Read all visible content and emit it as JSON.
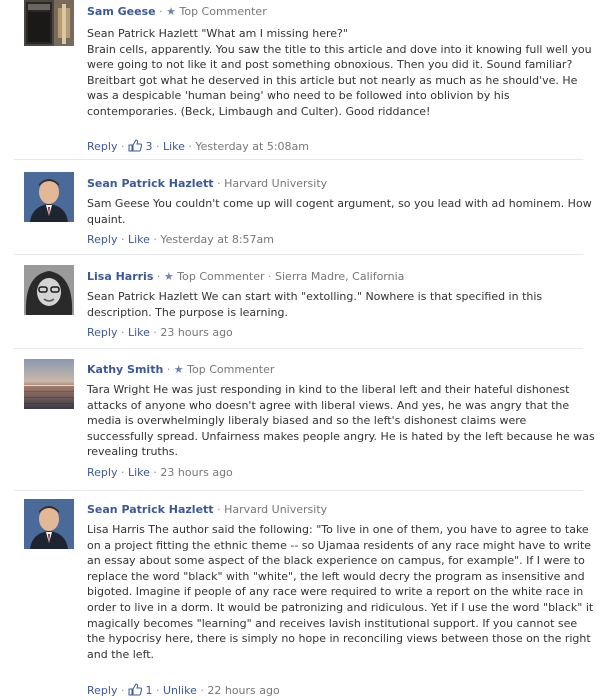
{
  "labels": {
    "reply": "Reply",
    "like": "Like",
    "unlike": "Unlike",
    "dot": "·"
  },
  "comments": [
    {
      "author": "Sam Geese",
      "meta": "Top Commenter",
      "body": [
        "Sean Patrick Hazlett \"What am I missing here?\"",
        "Brain cells, apparently. You saw the title to this article and dove into it knowing full well you were going to not like it and post something obnoxious. Then you did it. Sound familiar?",
        "Breitbart got what he deserved in this article but not nearly as much as he should've. He was a despicable 'human being' who need to be followed into oblivion by his contemporaries. (Beck, Limbaugh and Culter). Good riddance!"
      ],
      "like_count": "3",
      "time": "Yesterday at 5:08am"
    },
    {
      "author": "Sean Patrick Hazlett",
      "meta": "Harvard University",
      "body": [
        "Sam Geese You couldn't come up will cogent argument, so you lead with ad hominem. How quaint."
      ],
      "time": "Yesterday at 8:57am"
    },
    {
      "author": "Lisa Harris",
      "meta": "Top Commenter",
      "location": "Sierra Madre, California",
      "body": [
        "Sean Patrick Hazlett We can start with \"extolling.\" Nowhere is that specified in this description. The purpose is learning."
      ],
      "time": "23 hours ago"
    },
    {
      "author": "Kathy Smith",
      "meta": "Top Commenter",
      "body": [
        "Tara Wright He was just responding in kind to the liberal left and their hateful dishonest attacks of anyone who doesn't agree with liberal views. And yes, he was angry that the media is overwhelmingly liberaly biased and so the left's dishonest claims were successfully spread. Unfairness makes people angry. He is hated by the left because he was revealing truths."
      ],
      "time": "23 hours ago"
    },
    {
      "author": "Sean Patrick Hazlett",
      "meta": "Harvard University",
      "body": [
        "Lisa Harris The author said the following: \"To live in one of them, you have to agree to take on a project fitting the ethnic theme -- so Ujamaa residents of any race might have to write an essay about some aspect of the black experience on campus, for example\". If I were to replace the word \"black\" with \"white\", the left would decry the program as insensitive and bigoted. Imagine if people of any race were required to write a report on the white race in order to live in a dorm. It would be patronizing and ridiculous. Yet if I use the word \"black\" it magically becomes \"learning\" and receives lavish institutional support. If you cannot see the hypocrisy here, there is simply no hope in reconciling views between those on the right and the left."
      ],
      "like_count": "1",
      "time": "22 hours ago"
    }
  ]
}
